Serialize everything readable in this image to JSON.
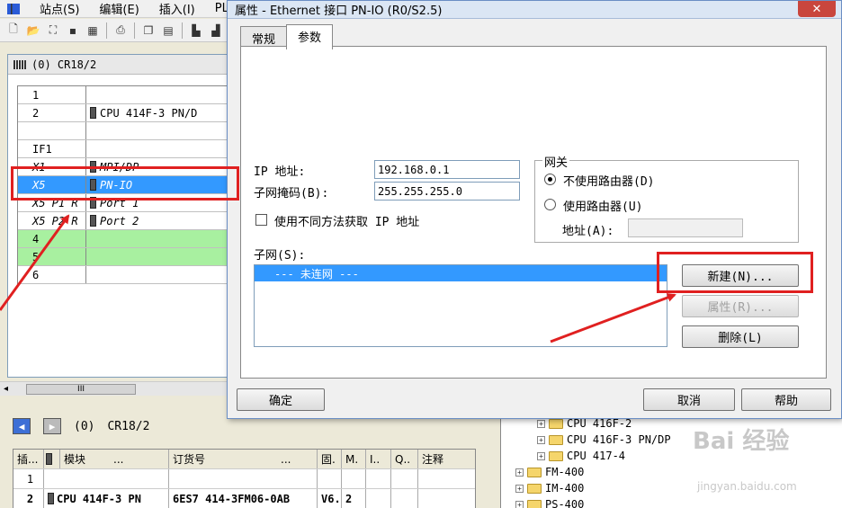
{
  "menubar": {
    "items": [
      "站点(S)",
      "编辑(E)",
      "插入(I)",
      "PLC"
    ]
  },
  "station": {
    "title": "(0) CR18/2",
    "rows": [
      {
        "slot": "1",
        "module": "",
        "style": "normal",
        "icon": false
      },
      {
        "slot": "2",
        "module": "CPU 414F-3 PN/D",
        "style": "normal",
        "icon": true
      },
      {
        "slot": "",
        "module": "",
        "style": "normal",
        "icon": false
      },
      {
        "slot": "IF1",
        "module": "",
        "style": "normal",
        "icon": false
      },
      {
        "slot": "X1",
        "module": "MPI/DP",
        "style": "italic",
        "icon": true
      },
      {
        "slot": "X5",
        "module": "PN-IO",
        "style": "selected",
        "icon": true
      },
      {
        "slot": "X5 P1 R",
        "module": "Port 1",
        "style": "italic",
        "icon": true
      },
      {
        "slot": "X5 P2 R",
        "module": "Port 2",
        "style": "italic",
        "icon": true
      },
      {
        "slot": "4",
        "module": "",
        "style": "green",
        "icon": false
      },
      {
        "slot": "5",
        "module": "",
        "style": "green",
        "icon": false
      },
      {
        "slot": "6",
        "module": "",
        "style": "normal",
        "icon": false
      }
    ]
  },
  "scroll_thumb": "III",
  "detail": {
    "station_slot": "(0)",
    "station_name": "CR18/2",
    "headers": [
      "插...",
      "模块",
      "...",
      "订货号",
      "...",
      "固.",
      "M.",
      "I..",
      "Q..",
      "注释"
    ],
    "rows": [
      [
        "1",
        "",
        "",
        "",
        "",
        "",
        "",
        "",
        ""
      ],
      [
        "2",
        "CPU 414F-3 PN",
        "6ES7 414-3FM06-0AB",
        "V6.",
        "2",
        "",
        "",
        "",
        ""
      ]
    ]
  },
  "catalog": {
    "items": [
      {
        "indent": 3,
        "label": "CPU 416F-2"
      },
      {
        "indent": 3,
        "label": "CPU 416F-3 PN/DP"
      },
      {
        "indent": 3,
        "label": "CPU 417-4"
      },
      {
        "indent": 1,
        "label": "FM-400"
      },
      {
        "indent": 1,
        "label": "IM-400"
      },
      {
        "indent": 1,
        "label": "PS-400"
      }
    ],
    "watermark": "Bai 经验",
    "watermark_url": "jingyan.baidu.com"
  },
  "dialog": {
    "title": "属性 - Ethernet 接口  PN-IO (R0/S2.5)",
    "close": "✕",
    "tabs": [
      "常规",
      "参数"
    ],
    "active_tab": 1,
    "ip_label": "IP 地址:",
    "ip_value": "192.168.0.1",
    "mask_label": "子网掩码(B):",
    "mask_value": "255.255.255.0",
    "other_method_label": "使用不同方法获取 IP 地址",
    "gateway": {
      "legend": "网关",
      "no_router": "不使用路由器(D)",
      "use_router": "使用路由器(U)",
      "address_label": "地址(A):",
      "address_value": ""
    },
    "subnet_label": "子网(S):",
    "subnet_item": "--- 未连网 ---",
    "buttons": {
      "new": "新建(N)...",
      "properties": "属性(R)...",
      "delete": "删除(L)",
      "ok": "确定",
      "cancel": "取消",
      "help": "帮助"
    }
  },
  "colors": {
    "annotation": "#e02020",
    "selection": "#3399ff",
    "empty_slot": "#a8f0a0"
  }
}
